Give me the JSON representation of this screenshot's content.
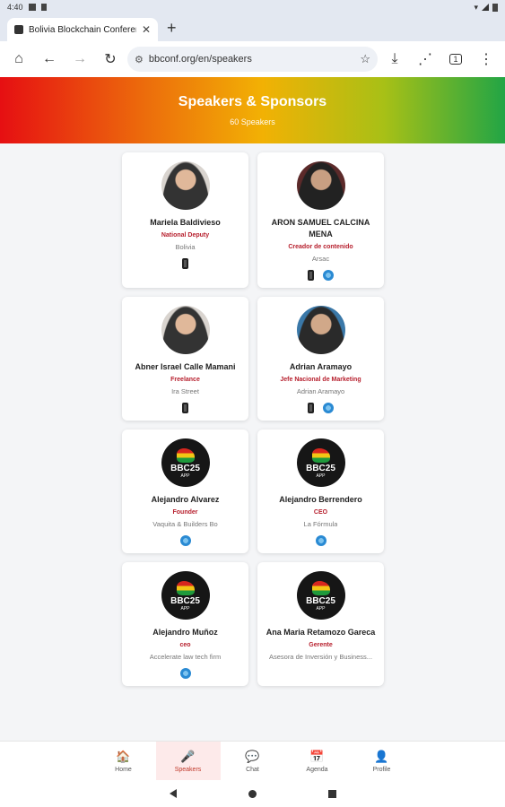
{
  "status_bar": {
    "time": "4:40"
  },
  "tab": {
    "title": "Bolivia Blockchain Conferen",
    "close": "✕",
    "new_tab": "+"
  },
  "toolbar": {
    "home": "⌂",
    "back": "←",
    "forward": "→",
    "reload": "↻",
    "url": "bbconf.org/en/speakers",
    "bookmark": "☆",
    "download": "⤓",
    "share": "⋰",
    "tabs": "1",
    "menu": "⋮"
  },
  "header": {
    "title": "Speakers & Sponsors",
    "subtitle": "60 Speakers"
  },
  "speakers": [
    {
      "name": "Mariela Baldivieso",
      "role": "National Deputy",
      "company": "Bolivia",
      "avatar": "photo",
      "phone": true,
      "web": false
    },
    {
      "name": "ARON SAMUEL CALCINA MENA",
      "role": "Creador de contenido",
      "company": "Arsac",
      "avatar": "photo",
      "phone": true,
      "web": true
    },
    {
      "name": "Abner Israel Calle Mamani",
      "role": "Freelance",
      "company": "Ira Street",
      "avatar": "photo",
      "phone": true,
      "web": false
    },
    {
      "name": "Adrian Aramayo",
      "role": "Jefe Nacional de Marketing",
      "company": "Adrian Aramayo",
      "avatar": "photo",
      "phone": true,
      "web": true
    },
    {
      "name": "Alejandro Alvarez",
      "role": "Founder",
      "company": "Vaquita & Builders Bo",
      "avatar": "logo",
      "phone": false,
      "web": true
    },
    {
      "name": "Alejandro Berrendero",
      "role": "CEO",
      "company": "La Fórmula",
      "avatar": "logo",
      "phone": false,
      "web": true
    },
    {
      "name": "Alejandro Muñoz",
      "role": "ceo",
      "company": "Accelerate law tech firm",
      "avatar": "logo",
      "phone": false,
      "web": true
    },
    {
      "name": "Ana Maria Retamozo Gareca",
      "role": "Gerente",
      "company": "Asesora de Inversión y Business...",
      "avatar": "logo",
      "phone": false,
      "web": false
    }
  ],
  "logo": {
    "text": "BBC25",
    "sub": "APP"
  },
  "bottom_nav": [
    {
      "label": "Home",
      "icon": "🏠",
      "active": false
    },
    {
      "label": "Speakers",
      "icon": "🎤",
      "active": true
    },
    {
      "label": "Chat",
      "icon": "💬",
      "active": false
    },
    {
      "label": "Agenda",
      "icon": "📅",
      "active": false
    },
    {
      "label": "Profile",
      "icon": "👤",
      "active": false
    }
  ],
  "colors": {
    "accent": "#b7202e",
    "gradient": [
      "#e60f12",
      "#f2b104",
      "#22a545"
    ]
  }
}
